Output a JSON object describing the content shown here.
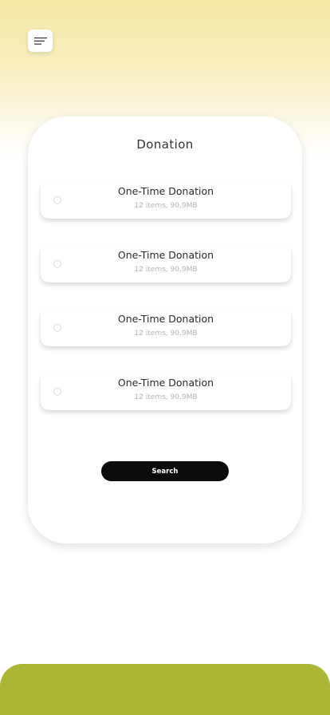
{
  "header": {
    "menu_icon": "menu-lines-icon"
  },
  "card": {
    "title": "Donation",
    "options": [
      {
        "label": "One-Time Donation",
        "subtitle": "12 items, 90.9MB"
      },
      {
        "label": "One-Time Donation",
        "subtitle": "12 items, 90.9MB"
      },
      {
        "label": "One-Time Donation",
        "subtitle": "12 items, 90.9MB"
      },
      {
        "label": "One-Time Donation",
        "subtitle": "12 items, 90.9MB"
      }
    ],
    "search_label": "Search"
  },
  "colors": {
    "accent": "#abb636",
    "button": "#0b0b0b",
    "gradient_top": "#f5e9a6"
  }
}
